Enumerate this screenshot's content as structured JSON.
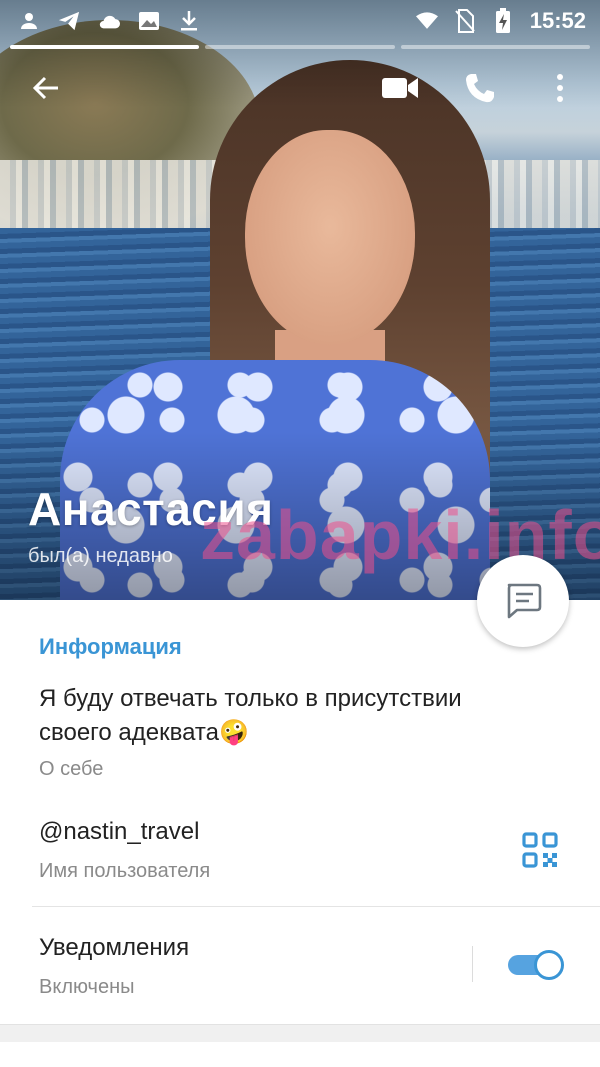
{
  "status_bar": {
    "time": "15:52",
    "left_icons": [
      "person-icon",
      "telegram-icon",
      "cloud-icon",
      "image-icon",
      "download-icon"
    ],
    "right_icons": [
      "wifi-icon",
      "no-sim-icon",
      "battery-charging-icon"
    ]
  },
  "profile": {
    "name": "Анастасия",
    "last_seen": "был(а) недавно",
    "watermark": "zabapki.info"
  },
  "info": {
    "section_title": "Информация",
    "bio": "Я буду отвечать только в присутствии своего адеквата🤪",
    "bio_label": "О себе",
    "username": "@nastin_travel",
    "username_label": "Имя пользователя",
    "notifications_label": "Уведомления",
    "notifications_value": "Включены",
    "notifications_enabled": true
  },
  "colors": {
    "accent": "#3a95d5",
    "toggle_track": "#56a3e0"
  }
}
